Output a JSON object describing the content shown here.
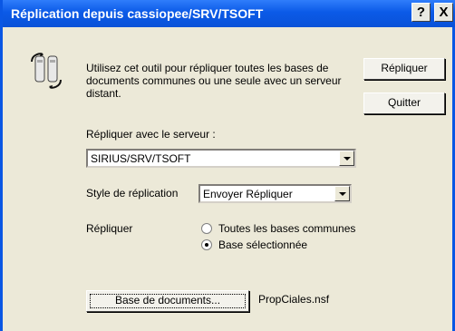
{
  "window": {
    "title": "Réplication depuis cassiopee/SRV/TSOFT",
    "help_label": "?",
    "close_label": "X"
  },
  "description": "Utilisez cet outil pour répliquer toutes les bases de documents communes ou une seule avec un serveur distant.",
  "buttons": {
    "replicate_label": "Répliquer",
    "quit_label": "Quitter",
    "database_label": "Base de documents..."
  },
  "server": {
    "label": "Répliquer avec le serveur :",
    "value": "SIRIUS/SRV/TSOFT"
  },
  "style": {
    "label": "Style de réplication",
    "value": "Envoyer Répliquer"
  },
  "replicate_scope": {
    "label": "Répliquer",
    "options": [
      {
        "label": "Toutes les bases communes",
        "selected": false
      },
      {
        "label": "Base sélectionnée",
        "selected": true
      }
    ]
  },
  "database": {
    "file": "PropCiales.nsf"
  },
  "icons": {
    "app": "replication-icon",
    "dropdown": "chevron-down-icon"
  },
  "colors": {
    "titlebar": "#0b5ae7",
    "dialog_bg": "#ece9d8"
  }
}
